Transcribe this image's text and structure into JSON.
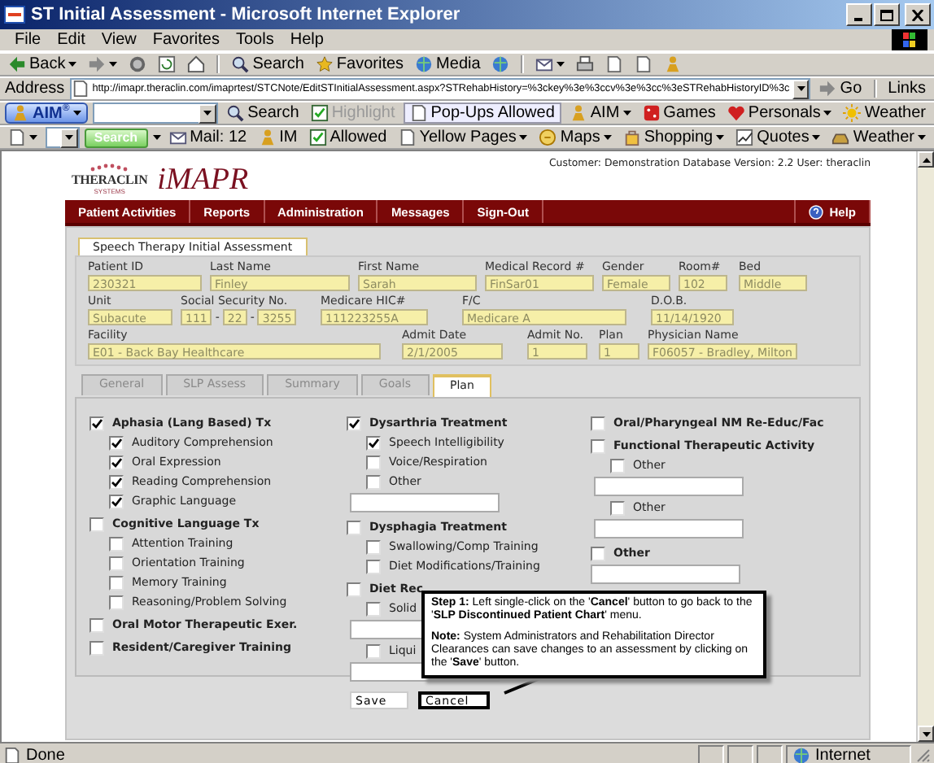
{
  "window": {
    "title": "ST Initial Assessment - Microsoft Internet Explorer"
  },
  "menu": [
    "File",
    "Edit",
    "View",
    "Favorites",
    "Tools",
    "Help"
  ],
  "nav_toolbar": {
    "back": "Back",
    "search": "Search",
    "favorites": "Favorites",
    "media": "Media"
  },
  "address_bar": {
    "label": "Address",
    "url": "http://imapr.theraclin.com/imaprtest/STCNote/EditSTInitialAssessment.aspx?STRehabHistory=%3ckey%3e%3ccv%3e%3cc%3eSTRehabHistoryID%3c",
    "go": "Go",
    "links": "Links"
  },
  "aim_toolbar": {
    "logo": "AIM$^{®}$",
    "search": "Search",
    "highlight": {
      "label": "Highlight",
      "disabled": true
    },
    "popups": "Pop-Ups Allowed",
    "items": [
      "AIM",
      "Games",
      "Personals",
      "Weather"
    ]
  },
  "search_toolbar": {
    "search": "Search",
    "items": [
      "Mail: 12",
      "IM",
      "Allowed",
      "Yellow Pages",
      "Maps",
      "Shopping",
      "Quotes",
      "Weather"
    ]
  },
  "header": {
    "logo_company": "THERACLIN",
    "logo_tagline": "SYSTEMS",
    "logo_product": "iMAPR",
    "info": "Customer: Demonstration Database Version: 2.2 User: theraclin"
  },
  "nav": {
    "items": [
      "Patient Activities",
      "Reports",
      "Administration",
      "Messages",
      "Sign-Out"
    ],
    "help": "Help"
  },
  "form_tab": "Speech Therapy Initial Assessment",
  "patient": {
    "rows": [
      [
        {
          "label": "Patient ID",
          "value": "230321"
        },
        {
          "label": "Last Name",
          "value": "Finley"
        },
        {
          "label": "First Name",
          "value": "Sarah"
        },
        {
          "label": "Medical Record #",
          "value": "FinSar01"
        },
        {
          "label": "Gender",
          "value": "Female"
        },
        {
          "label": "Room#",
          "value": "102"
        },
        {
          "label": "Bed",
          "value": "Middle"
        }
      ],
      [
        {
          "label": "Unit",
          "value": "Subacute"
        },
        {
          "label": "Social Security No.",
          "segments": [
            {
              "kind": "input",
              "text": "111"
            },
            {
              "kind": "separator",
              "text": "-"
            },
            {
              "kind": "input",
              "text": "22"
            },
            {
              "kind": "separator",
              "text": "-"
            },
            {
              "kind": "input",
              "text": "3255"
            }
          ]
        },
        {
          "label": "Medicare HIC#",
          "value": "111223255A"
        },
        {
          "label": "F/C",
          "value": "Medicare A"
        },
        {
          "label": "D.O.B.",
          "value": "11/14/1920"
        }
      ],
      [
        {
          "label": "Facility",
          "value": "E01 - Back Bay Healthcare"
        },
        {
          "label": "Admit Date",
          "value": "2/1/2005"
        },
        {
          "label": "Admit No.",
          "value": "1"
        },
        {
          "label": "Plan",
          "value": "1"
        },
        {
          "label": "Physician Name",
          "value": "F06057 - Bradley, Milton"
        }
      ]
    ]
  },
  "plan_tabs": [
    {
      "label": "General",
      "selected": false
    },
    {
      "label": "SLP Assess",
      "selected": false
    },
    {
      "label": "Summary",
      "selected": false
    },
    {
      "label": "Goals",
      "selected": false
    },
    {
      "label": "Plan",
      "selected": true
    }
  ],
  "plan": {
    "columns": [
      {
        "items": [
          {
            "label": "Aphasia (Lang Based) Tx",
            "checked": true,
            "children": [
              {
                "label": "Auditory Comprehension",
                "checked": true
              },
              {
                "label": "Oral Expression",
                "checked": true
              },
              {
                "label": "Reading Comprehension",
                "checked": true
              },
              {
                "label": "Graphic Language",
                "checked": true
              }
            ]
          },
          {
            "label": "Cognitive Language Tx",
            "checked": false,
            "children": [
              {
                "label": "Attention Training",
                "checked": false
              },
              {
                "label": "Orientation Training",
                "checked": false
              },
              {
                "label": "Memory Training",
                "checked": false
              },
              {
                "label": "Reasoning/Problem Solving",
                "checked": false
              }
            ]
          },
          {
            "label": "Oral Motor Therapeutic Exer.",
            "checked": false
          },
          {
            "label": "Resident/Caregiver Training",
            "checked": false
          }
        ]
      },
      {
        "items": [
          {
            "label": "Dysarthria Treatment",
            "checked": true,
            "children": [
              {
                "label": "Speech Intelligibility",
                "checked": true
              },
              {
                "label": "Voice/Respiration",
                "checked": false
              },
              {
                "label": "Other",
                "checked": false,
                "field": true
              }
            ]
          },
          {
            "label": "Dysphagia Treatment",
            "checked": false,
            "children": [
              {
                "label": "Swallowing/Comp Training",
                "checked": false
              },
              {
                "label": "Diet Modifications/Training",
                "checked": false
              }
            ]
          },
          {
            "label": "Diet Rec",
            "checked": false,
            "children": [
              {
                "label": "Solid",
                "checked": false,
                "field": true
              },
              {
                "label": "Liqui",
                "checked": false,
                "field": true
              }
            ]
          }
        ]
      },
      {
        "items": [
          {
            "label": "Oral/Pharyngeal NM Re-Educ/Fac",
            "checked": false
          },
          {
            "label": "Functional Therapeutic Activity",
            "checked": false,
            "children": [
              {
                "label": "Other",
                "checked": false,
                "field": true
              },
              {
                "label": "Other",
                "checked": false,
                "field": true
              }
            ]
          },
          {
            "label": "Other",
            "checked": false,
            "field": true
          }
        ]
      }
    ]
  },
  "buttons": [
    {
      "label": "Save",
      "highlighted": false
    },
    {
      "label": "Cancel",
      "highlighted": true
    }
  ],
  "callout": {
    "step": "**Step 1:** Left single-click on the '**Cancel**' button to go back to the '**SLP Discontinued Patient Chart**' menu.",
    "note": "**Note:** System Administrators and Rehabilitation Director Clearances can save changes to an assessment by clicking on the '**Save**' button."
  },
  "status_bar": {
    "text": "Done",
    "zone": "Internet"
  }
}
